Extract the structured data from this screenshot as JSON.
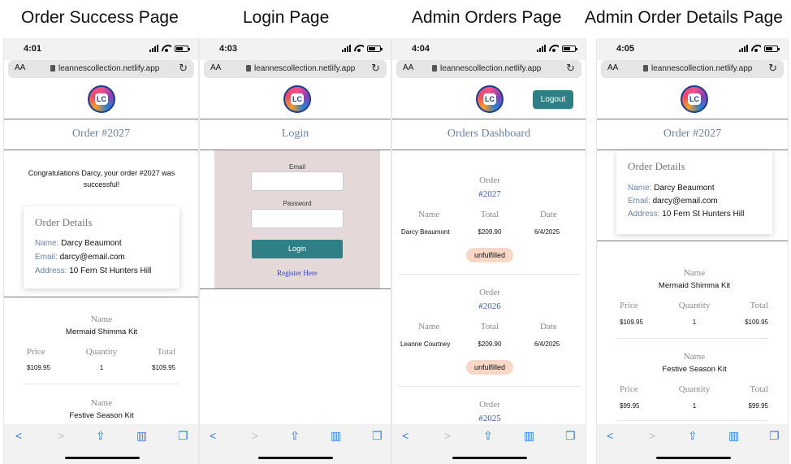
{
  "titles": [
    "Order Success Page",
    "Login Page",
    "Admin Orders Page",
    "Admin Order Details Page"
  ],
  "browser": {
    "url": "leannescollection.netlify.app",
    "aa": "AA",
    "logo_text": "LC"
  },
  "order_success": {
    "time": "4:01",
    "heading": "Order #2027",
    "message": "Congratulations Darcy, your order #2027 was successful!",
    "card": {
      "title": "Order Details",
      "name_label": "Name:",
      "name": "Darcy Beaumont",
      "email_label": "Email:",
      "email": "darcy@email.com",
      "address_label": "Address:",
      "address": "10 Fern St Hunters Hill"
    },
    "items": [
      {
        "name_label": "Name",
        "name": "Mermaid Shimma Kit",
        "price_label": "Price",
        "qty_label": "Quantity",
        "total_label": "Total",
        "price": "$109.95",
        "qty": "1",
        "total": "$109.95"
      },
      {
        "name_label": "Name",
        "name": "Festive Season Kit"
      }
    ]
  },
  "login": {
    "time": "4:03",
    "heading": "Login",
    "email_label": "Email",
    "password_label": "Password",
    "button": "Login",
    "register": "Register Here"
  },
  "admin_orders": {
    "time": "4:04",
    "logout": "Logout",
    "heading": "Orders Dashboard",
    "order_label": "Order",
    "col_name": "Name",
    "col_total": "Total",
    "col_date": "Date",
    "orders": [
      {
        "id": "#2027",
        "name": "Darcy Beaumont",
        "total": "$209.90",
        "date": "6/4/2025",
        "status": "unfulfilled"
      },
      {
        "id": "#2026",
        "name": "Leanne Courtney",
        "total": "$209.90",
        "date": "6/4/2025",
        "status": "unfulfilled"
      },
      {
        "id": "#2025"
      }
    ]
  },
  "admin_details": {
    "time": "4:05",
    "heading": "Order #2027",
    "card": {
      "title": "Order Details",
      "name_label": "Name:",
      "name": "Darcy Beaumont",
      "email_label": "Email:",
      "email": "darcy@email.com",
      "address_label": "Address:",
      "address": "10 Fern St Hunters Hill"
    },
    "items": [
      {
        "name_label": "Name",
        "name": "Mermaid Shimma Kit",
        "price_label": "Price",
        "qty_label": "Quantity",
        "total_label": "Total",
        "price": "$109.95",
        "qty": "1",
        "total": "$109.95"
      },
      {
        "name_label": "Name",
        "name": "Festive Season Kit",
        "price_label": "Price",
        "qty_label": "Quantity",
        "total_label": "Total",
        "price": "$99.95",
        "qty": "1",
        "total": "$99.95"
      }
    ]
  },
  "colors": {
    "accent": "#2f7f86",
    "heading": "#6b83a6",
    "badge": "#f9d7c6",
    "login_bg": "#e4d8d8",
    "link": "#3a5db5"
  }
}
